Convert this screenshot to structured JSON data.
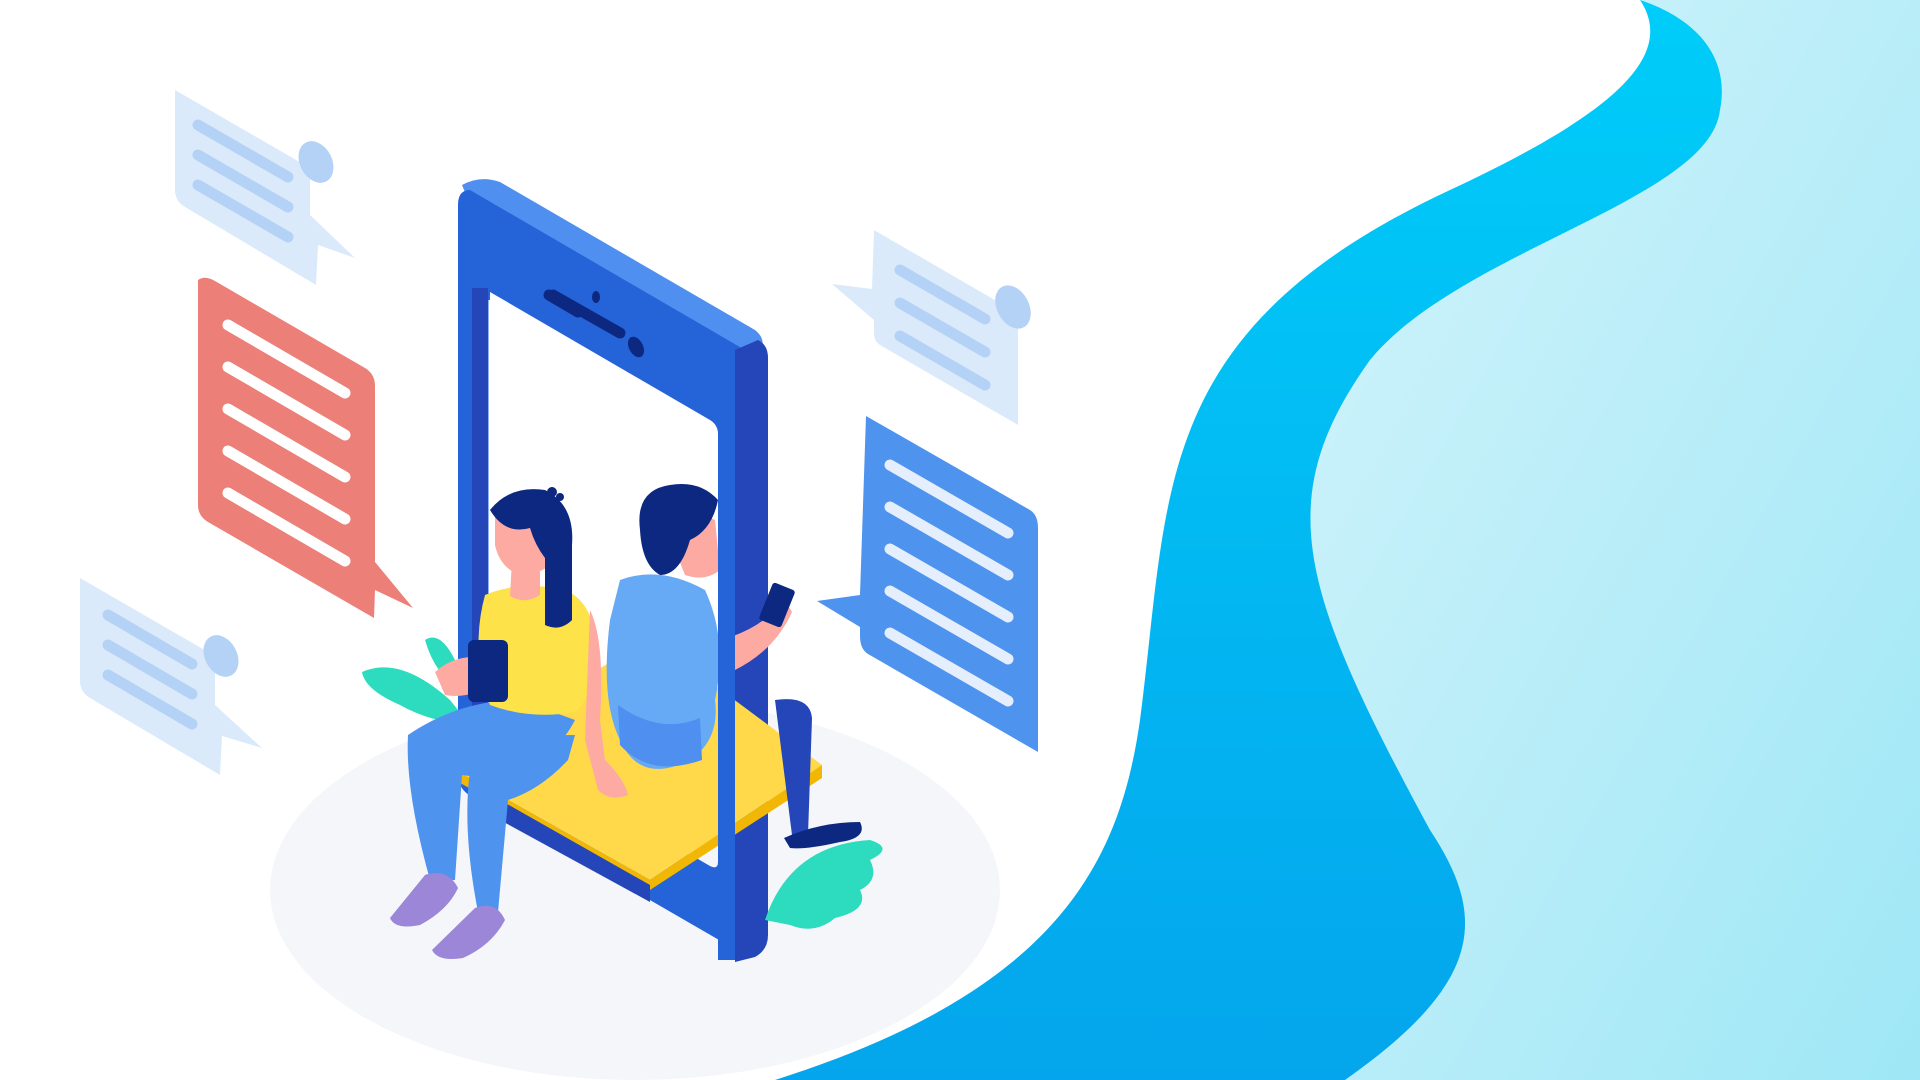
{
  "illustration": {
    "subject": "isometric-chat-illustration",
    "texts": []
  },
  "colors": {
    "background": "#ffffff",
    "wave_light": "#d3f4fb",
    "wave_light_far": "#9fe7f6",
    "wave_dark": "#00cdf9",
    "wave_dark_far": "#04a5ec",
    "phone_front": "#2563d9",
    "phone_side": "#2446b8",
    "phone_top": "#4f8ff0",
    "bench": "#ffd94a",
    "bench_edge": "#f2b705",
    "bubble_red": "#ec7f78",
    "bubble_blue": "#4e93ee",
    "bubble_faint": "#dbeafb",
    "bubble_faint_lines": "#b4d2f6",
    "leaf": "#2ddbbe",
    "skin": "#fdaaa3",
    "hair": "#0d2880",
    "girl_shirt": "#fde24a",
    "jeans": "#4e93ee",
    "boy_shirt": "#66aaf6",
    "shoes": "#9b86d8",
    "shadow": "#f4f6fa"
  },
  "icons": [
    "chat-bubble-icon",
    "smartphone-icon",
    "leaf-icon"
  ]
}
